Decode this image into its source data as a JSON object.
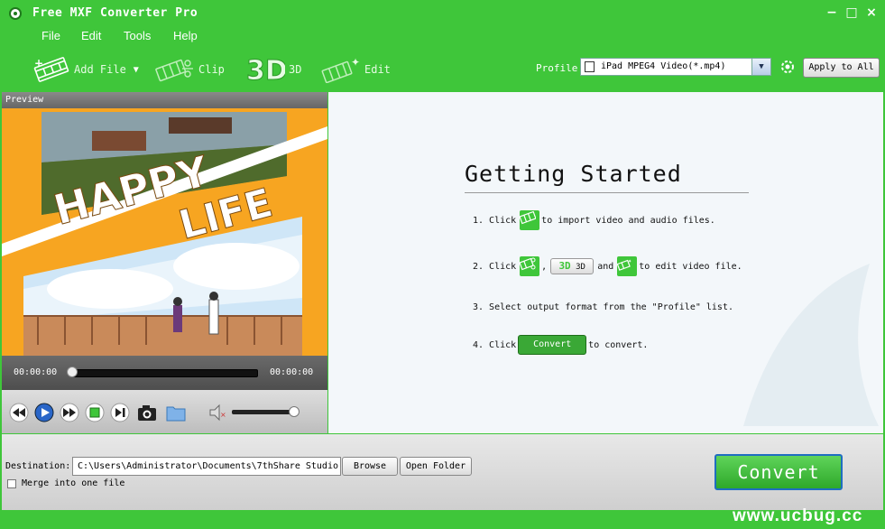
{
  "window": {
    "title": "Free MXF Converter Pro",
    "minimize": "−",
    "maximize": "□",
    "close": "×"
  },
  "menu": [
    "File",
    "Edit",
    "Tools",
    "Help"
  ],
  "toolbar": {
    "add_file": "Add File",
    "clip": "Clip",
    "three_d": "3D",
    "edit": "Edit",
    "profile_label": "Profile:",
    "profile_value": "iPad MPEG4 Video(*.mp4)",
    "apply_all": "Apply to All"
  },
  "preview": {
    "header": "Preview",
    "image_text_1": "HAPPY",
    "image_text_2": "LIFE",
    "time_current": "00:00:00",
    "time_total": "00:00:00",
    "progress": 0,
    "volume": 0.95
  },
  "getting_started": {
    "title": "Getting Started",
    "step1_pre": "1. Click",
    "step1_post": "to import video and audio files.",
    "step2_pre": "2. Click",
    "step2_comma": ",",
    "step2_3d": "3D",
    "step2_and": "and",
    "step2_post": "to edit video file.",
    "step3": "3. Select output format from the \"Profile\" list.",
    "step4_pre": "4. Click",
    "step4_btn": "Convert",
    "step4_post": "to convert."
  },
  "bottom": {
    "destination_label": "Destination:",
    "destination_value": "C:\\Users\\Administrator\\Documents\\7thShare Studio",
    "browse": "Browse",
    "open_folder": "Open Folder",
    "merge_label": "Merge into one file",
    "convert": "Convert"
  },
  "watermark": "www.ucbug.cc",
  "colors": {
    "brand_green": "#3fc63a",
    "accent_orange": "#f7a521"
  }
}
